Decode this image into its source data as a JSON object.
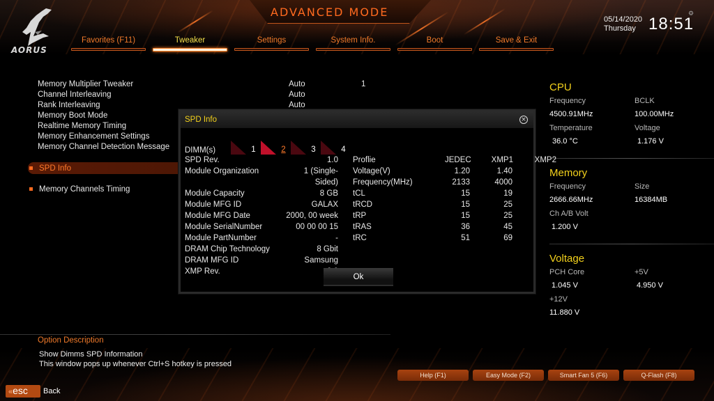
{
  "header": {
    "brand": "AORUS",
    "mode_title": "ADVANCED MODE",
    "date": "05/14/2020",
    "day": "Thursday",
    "time": "18:51"
  },
  "tabs": [
    {
      "label": "Favorites (F11)",
      "active": false
    },
    {
      "label": "Tweaker",
      "active": true
    },
    {
      "label": "Settings",
      "active": false
    },
    {
      "label": "System Info.",
      "active": false
    },
    {
      "label": "Boot",
      "active": false
    },
    {
      "label": "Save & Exit",
      "active": false
    }
  ],
  "settings": [
    {
      "label": "Memory Multiplier Tweaker",
      "value": "Auto",
      "extra": "1"
    },
    {
      "label": "Channel Interleaving",
      "value": "Auto",
      "extra": ""
    },
    {
      "label": "Rank Interleaving",
      "value": "Auto",
      "extra": ""
    },
    {
      "label": "Memory Boot Mode",
      "value": "",
      "extra": ""
    },
    {
      "label": "Realtime Memory Timing",
      "value": "",
      "extra": ""
    },
    {
      "label": "Memory Enhancement Settings",
      "value": "",
      "extra": ""
    },
    {
      "label": "Memory Channel Detection Message",
      "value": "",
      "extra": ""
    }
  ],
  "submenus": {
    "spd_info": "SPD Info",
    "memory_channels_timing": "Memory Channels Timing"
  },
  "dialog": {
    "title": "SPD Info",
    "dimm_label": "DIMM(s)",
    "dimms": [
      {
        "num": "1",
        "active": false
      },
      {
        "num": "2",
        "active": true
      },
      {
        "num": "3",
        "active": false
      },
      {
        "num": "4",
        "active": false
      }
    ],
    "module_info": [
      {
        "key": "SPD Rev.",
        "value": "1.0"
      },
      {
        "key": "Module Organization",
        "value": "1 (Single-Sided)"
      },
      {
        "key": "Module Capacity",
        "value": "8 GB"
      },
      {
        "key": "Module MFG ID",
        "value": "GALAX"
      },
      {
        "key": "Module MFG Date",
        "value": "2000, 00 week"
      },
      {
        "key": "Module SerialNumber",
        "value": "00 00 00 15"
      },
      {
        "key": "Module PartNumber",
        "value": "-"
      },
      {
        "key": "DRAM Chip Technology",
        "value": "8 Gbit"
      },
      {
        "key": "DRAM MFG ID",
        "value": "Samsung"
      },
      {
        "key": "XMP Rev.",
        "value": "2.0"
      }
    ],
    "profile_header": {
      "key": "Proflie",
      "jedec": "JEDEC",
      "xmp1": "XMP1",
      "xmp2": "XMP2"
    },
    "profile_rows": [
      {
        "key": "Voltage(V)",
        "jedec": "1.20",
        "xmp1": "1.40",
        "xmp2": ""
      },
      {
        "key": "Frequency(MHz)",
        "jedec": "2133",
        "xmp1": "4000",
        "xmp2": ""
      },
      {
        "key": "tCL",
        "jedec": "15",
        "xmp1": "19",
        "xmp2": ""
      },
      {
        "key": "tRCD",
        "jedec": "15",
        "xmp1": "25",
        "xmp2": ""
      },
      {
        "key": "tRP",
        "jedec": "15",
        "xmp1": "25",
        "xmp2": ""
      },
      {
        "key": "tRAS",
        "jedec": "36",
        "xmp1": "45",
        "xmp2": ""
      },
      {
        "key": "tRC",
        "jedec": "51",
        "xmp1": "69",
        "xmp2": ""
      }
    ],
    "ok_label": "Ok"
  },
  "right_panel": {
    "cpu": {
      "title": "CPU",
      "frequency_label": "Frequency",
      "frequency": "4500.91MHz",
      "bclk_label": "BCLK",
      "bclk": "100.00MHz",
      "temperature_label": "Temperature",
      "temperature": "36.0 °C",
      "voltage_label": "Voltage",
      "voltage": "1.176 V"
    },
    "memory": {
      "title": "Memory",
      "frequency_label": "Frequency",
      "frequency": "2666.66MHz",
      "size_label": "Size",
      "size": "16384MB",
      "volt_label": "Ch A/B Volt",
      "volt": "1.200 V"
    },
    "voltage": {
      "title": "Voltage",
      "pch_label": "PCH Core",
      "pch": "1.045 V",
      "v5_label": "+5V",
      "v5": "4.950 V",
      "v12_label": "+12V",
      "v12": "11.880 V"
    }
  },
  "description": {
    "title": "Option Description",
    "line1": "Show Dimms SPD Information",
    "line2": "This window pops up whenever Ctrl+S hotkey is pressed"
  },
  "footer": {
    "esc_label": "esc",
    "back_label": "Back",
    "fkeys": [
      "Help (F1)",
      "Easy Mode (F2)",
      "Smart Fan 5 (F6)",
      "Q-Flash (F8)"
    ]
  },
  "colors": {
    "accent_orange": "#f07a2a",
    "accent_yellow": "#f4d21c",
    "dimm_active": "#c0102a"
  }
}
